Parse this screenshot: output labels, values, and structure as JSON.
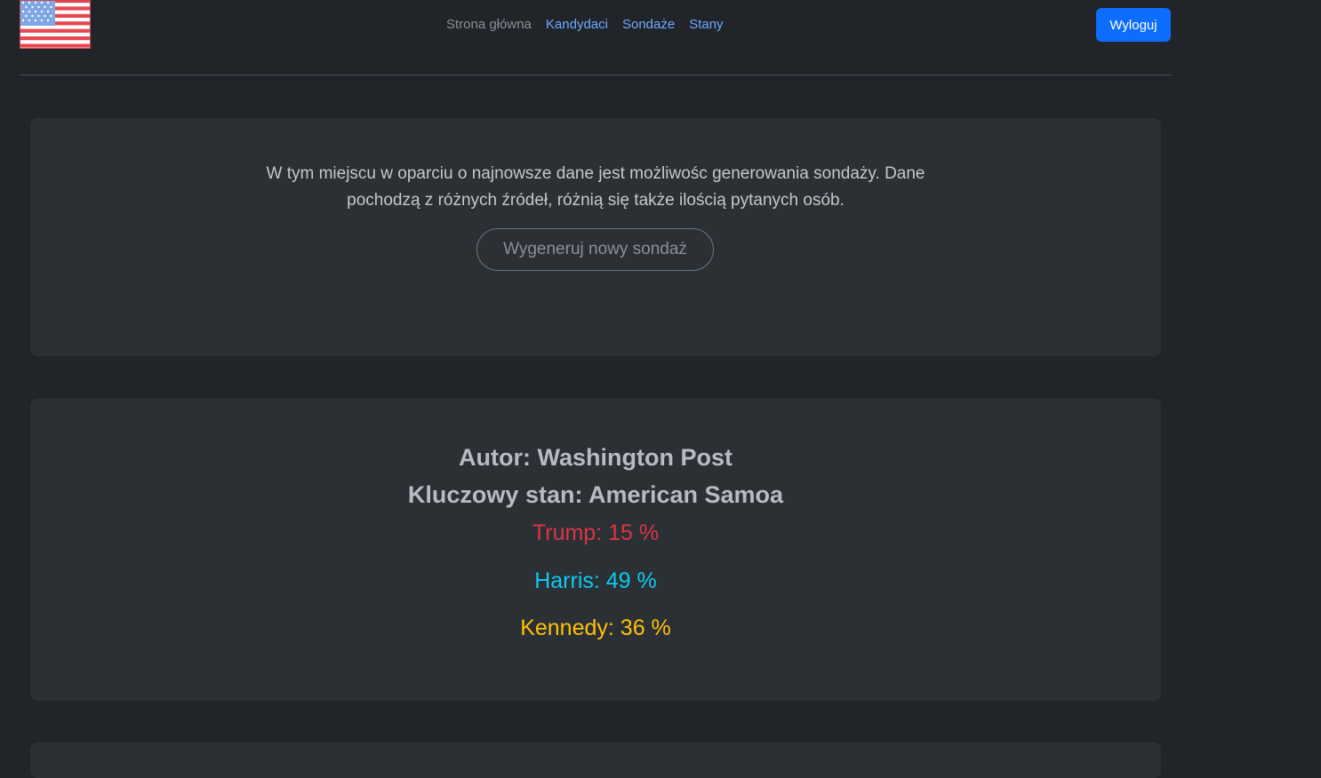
{
  "nav": {
    "items": [
      {
        "label": "Strona główna",
        "active": true
      },
      {
        "label": "Kandydaci",
        "active": false
      },
      {
        "label": "Sondaże",
        "active": false
      },
      {
        "label": "Stany",
        "active": false
      }
    ],
    "logout_label": "Wyloguj"
  },
  "intro": {
    "text": "W tym miejscu w oparciu o najnowsze dane jest możliwośc generowania sondaży. Dane pochodzą z różnych źródeł, różnią się także ilością pytanych osób.",
    "generate_label": "Wygeneruj nowy sondaż"
  },
  "poll": {
    "author": "Autor: Washington Post",
    "key_state": "Kluczowy stan: American Samoa",
    "results": [
      {
        "text": "Trump: 15 %",
        "color": "#dc3545"
      },
      {
        "text": "Harris: 49 %",
        "color": "#0dcaf0"
      },
      {
        "text": "Kennedy: 36 %",
        "color": "#ffc107"
      }
    ]
  },
  "colors": {
    "background": "#212529",
    "card": "#2b3035",
    "primary": "#0d6efd",
    "link": "#6ea8fe"
  },
  "icons": {
    "logo": "us-flag-icon"
  }
}
